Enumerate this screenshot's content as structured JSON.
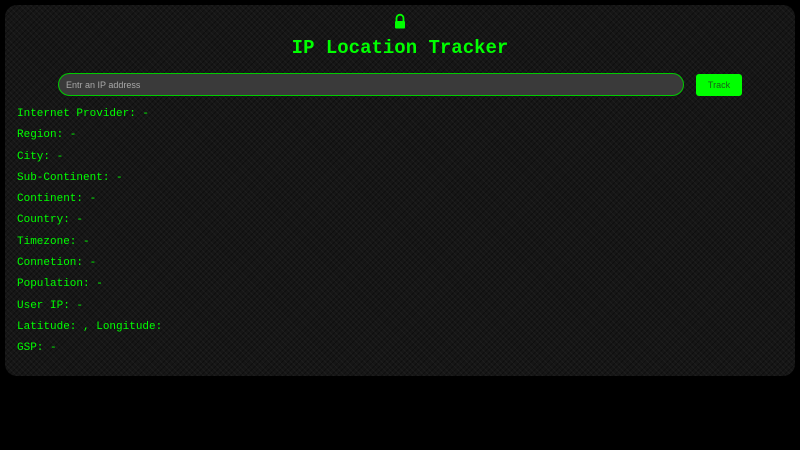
{
  "app": {
    "title": "IP Location Tracker",
    "icon": "lock-icon",
    "accent_color": "#00ff00"
  },
  "search": {
    "placeholder": "Entr an IP address",
    "value": "",
    "button_label": "Track"
  },
  "info": {
    "internet_provider": "Internet Provider: -",
    "region": "Region: -",
    "city": "City: -",
    "sub_continent": "Sub-Continent: -",
    "continent": "Continent: -",
    "country": "Country: -",
    "timezone": "Timezone: -",
    "connection": "Connetion: -",
    "population": "Population: -",
    "user_ip": "User IP: -",
    "lat_long": "Latitude: , Longitude:",
    "gsp": "GSP: -"
  }
}
